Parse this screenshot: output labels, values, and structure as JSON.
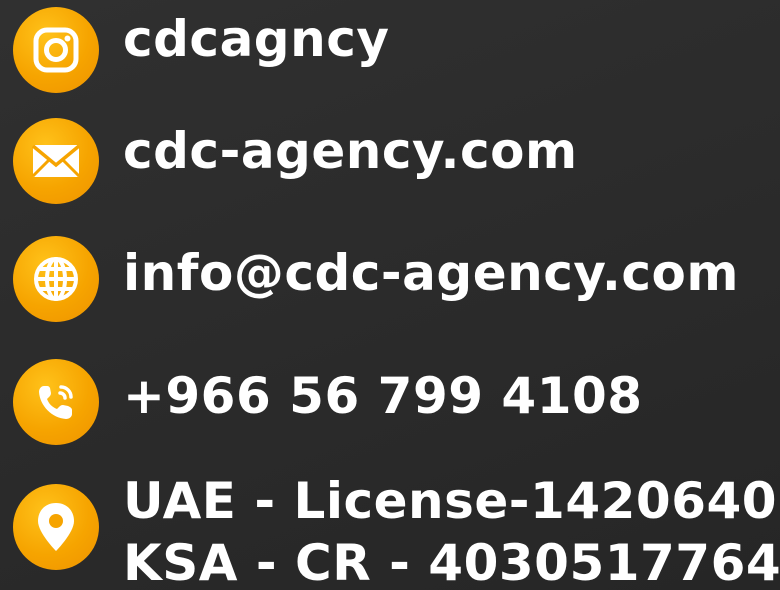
{
  "contacts": {
    "instagram": {
      "icon": "instagram-icon",
      "text": "cdcagncy"
    },
    "website": {
      "icon": "mail-icon",
      "text": "cdc-agency.com"
    },
    "email": {
      "icon": "globe-icon",
      "text": "info@cdc-agency.com"
    },
    "phone": {
      "icon": "phone-icon",
      "text": "+966 56 799 4108"
    },
    "location": {
      "icon": "location-pin-icon",
      "line1": "UAE - License-1420640",
      "line2": "KSA - CR - 4030517764"
    }
  },
  "colors": {
    "background": "#2b2b2b",
    "accent": "#f6a400",
    "text": "#ffffff"
  }
}
